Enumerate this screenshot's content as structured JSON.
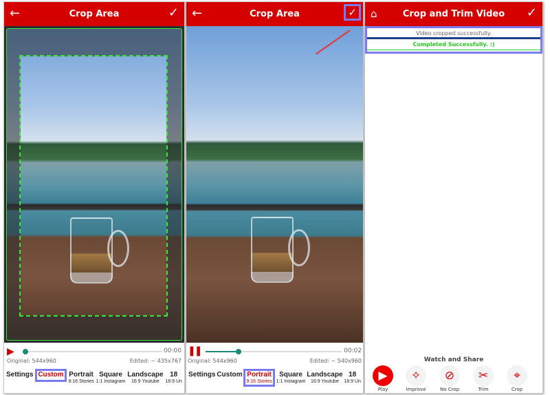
{
  "panels": [
    {
      "title": "Crop Area",
      "back_icon": "arrow-left-icon",
      "confirm_icon": "check-icon",
      "time": "00:00",
      "original": "Original: 544x960",
      "edited": "Edited: ~ 435x767",
      "tabs": [
        {
          "label": "Settings"
        },
        {
          "label": "Custom",
          "selected": true
        },
        {
          "label": "Portrait",
          "sub": "9:16 Stories"
        },
        {
          "label": "Square",
          "sub": "1:1 Instagram"
        },
        {
          "label": "Landscape",
          "sub": "16:9 Youtube"
        },
        {
          "label": "18",
          "sub": "18:9 Un"
        }
      ],
      "progress": 0
    },
    {
      "title": "Crop Area",
      "back_icon": "arrow-left-icon",
      "confirm_icon": "check-icon",
      "time": "00:02",
      "original": "Original: 544x960",
      "edited": "Edited: ~ 540x960",
      "tabs": [
        {
          "label": "Settings"
        },
        {
          "label": "Custom"
        },
        {
          "label": "Portrait",
          "sub": "9:16 Stories",
          "selected": true
        },
        {
          "label": "Square",
          "sub": "1:1 Instagram"
        },
        {
          "label": "Landscape",
          "sub": "16:9 Youtube"
        },
        {
          "label": "18",
          "sub": "18:9 Un"
        }
      ],
      "progress": 0.25
    },
    {
      "title": "Crop and Trim Video",
      "home_icon": "home-icon",
      "confirm_icon": "check-icon",
      "status": "Video cropped successfully.",
      "completed": "Completed Successfully. :)",
      "section": "Watch and Share",
      "actions": [
        {
          "label": "Play",
          "icon": "play-icon"
        },
        {
          "label": "Improve",
          "icon": "magic-wand-icon"
        },
        {
          "label": "No Crop",
          "icon": "no-icon"
        },
        {
          "label": "Trim",
          "icon": "scissors-icon"
        },
        {
          "label": "Crop",
          "icon": "crop-icon"
        }
      ]
    }
  ],
  "colors": {
    "header": "#d50000",
    "highlight": "#7b7bf0",
    "accent": "#1a8a7a",
    "success": "#22cc22"
  }
}
